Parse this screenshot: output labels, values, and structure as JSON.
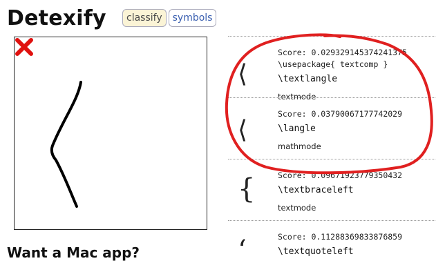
{
  "header": {
    "title": "Detexify",
    "tabs": [
      {
        "label": "classify",
        "active": true
      },
      {
        "label": "symbols",
        "active": false
      }
    ]
  },
  "canvas": {
    "clear_icon": "x-icon",
    "clear_color": "#e0110f"
  },
  "promo": {
    "heading": "Want a Mac app?"
  },
  "results": [
    {
      "glyph": "⟨",
      "score": "Score: 0.029329145374241375",
      "package": "\\usepackage{ textcomp }",
      "command": "\\textlangle",
      "mode": "textmode"
    },
    {
      "glyph": "⟨",
      "score": "Score: 0.03790067177742029",
      "package": "",
      "command": "\\langle",
      "mode": "mathmode"
    },
    {
      "glyph": "{",
      "score": "Score: 0.09671923779350432",
      "package": "",
      "command": "\\textbraceleft",
      "mode": "textmode"
    },
    {
      "glyph": "‘",
      "score": "Score: 0.11288369833876859",
      "package": "",
      "command": "\\textquoteleft",
      "mode": ""
    }
  ],
  "annotation_color": "#e02020"
}
